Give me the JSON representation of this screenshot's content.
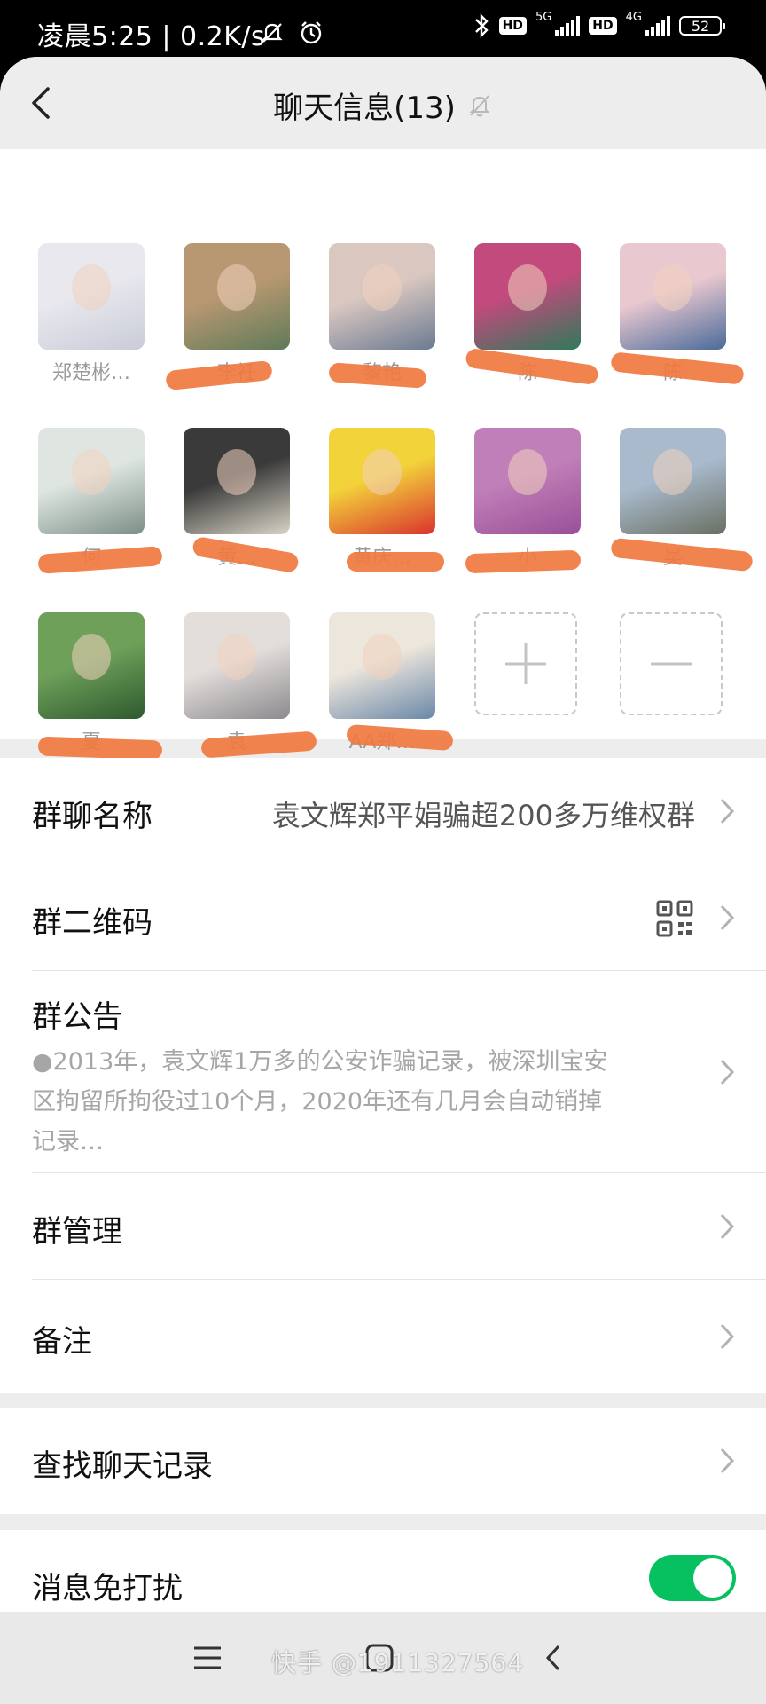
{
  "status_bar": {
    "time_text": "凌晨5:25 | 0.2K/s",
    "net_5g": "5G",
    "net_4g": "4G",
    "hd": "HD",
    "battery": "52"
  },
  "header": {
    "title": "聊天信息(13)",
    "icons": [
      "back-icon",
      "bell-off-icon"
    ]
  },
  "members": [
    {
      "name": "郑楚彬…",
      "avatar_colors": [
        "#e8e8ee",
        "#c9ccd8"
      ]
    },
    {
      "name": "李衽",
      "avatar_colors": [
        "#b89872",
        "#5f7a58"
      ]
    },
    {
      "name": "黎艳",
      "avatar_colors": [
        "#d9c7c0",
        "#6b7a92"
      ]
    },
    {
      "name": "陈",
      "avatar_colors": [
        "#c24a7c",
        "#2f7a5a"
      ]
    },
    {
      "name": "陈",
      "avatar_colors": [
        "#e9c8cf",
        "#4a6a9a"
      ]
    },
    {
      "name": "何",
      "avatar_colors": [
        "#dfe6e2",
        "#7b8f86"
      ]
    },
    {
      "name": "黄…",
      "avatar_colors": [
        "#3a3a3a",
        "#d9d4c6"
      ]
    },
    {
      "name": "黄庆…",
      "avatar_colors": [
        "#f3d33a",
        "#d9332f"
      ]
    },
    {
      "name": "小",
      "avatar_colors": [
        "#c07fb8",
        "#9a4f98"
      ]
    },
    {
      "name": "吴",
      "avatar_colors": [
        "#a8bacc",
        "#6a6f63"
      ]
    },
    {
      "name": "夏",
      "avatar_colors": [
        "#6fa05a",
        "#2d5a2e"
      ]
    },
    {
      "name": "袁",
      "avatar_colors": [
        "#e4dedb",
        "#8b8a8e"
      ]
    },
    {
      "name": "AA郑…",
      "avatar_colors": [
        "#ede6dc",
        "#6a88a8"
      ]
    }
  ],
  "member_actions": {
    "add_icon": "plus-icon",
    "remove_icon": "minus-icon"
  },
  "settings": {
    "group_name_label": "群聊名称",
    "group_name_value": "袁文辉郑平娟骗超200多万维权群",
    "qr_label": "群二维码",
    "qr_icon": "qr-code-icon",
    "announcement_label": "群公告",
    "announcement_lines": [
      "●2013年，袁文辉1万多的公安诈骗记录，被深圳宝安",
      "区拘留所拘役过10个月，2020年还有几月会自动销掉",
      "记录…"
    ],
    "manage_label": "群管理",
    "remark_label": "备注",
    "search_label": "查找聊天记录",
    "mute_label": "消息免打扰",
    "mute_on": true
  },
  "bottom_nav": {
    "icons": [
      "menu-icon",
      "home-icon",
      "back-icon"
    ],
    "watermark": "快手 @1911327564"
  },
  "colors": {
    "toggle_on": "#07c160",
    "redaction": "#f07840",
    "page_bg": "#ededed"
  }
}
